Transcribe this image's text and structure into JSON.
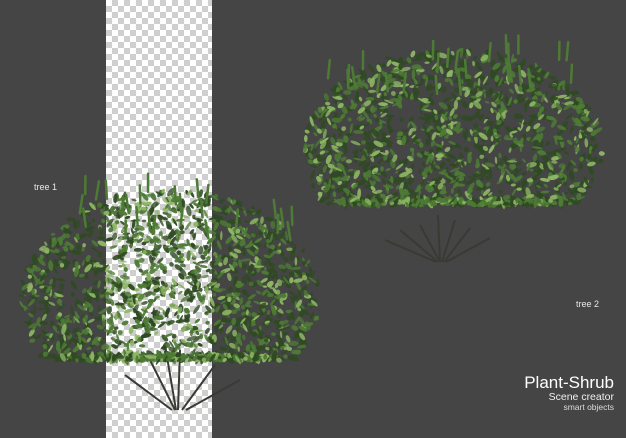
{
  "scene": {
    "background_color": "#454545",
    "transparency_checkerboard": true
  },
  "labels": {
    "tree1": "tree 1",
    "tree2": "tree 2"
  },
  "watermark": {
    "title": "Plant-Shrub",
    "subtitle": "Scene creator",
    "caption": "smart objects"
  },
  "colors": {
    "foliage_dark": "#2f4a22",
    "foliage_mid": "#4d7a35",
    "foliage_light": "#8db564",
    "stems": "#3a3a34"
  }
}
